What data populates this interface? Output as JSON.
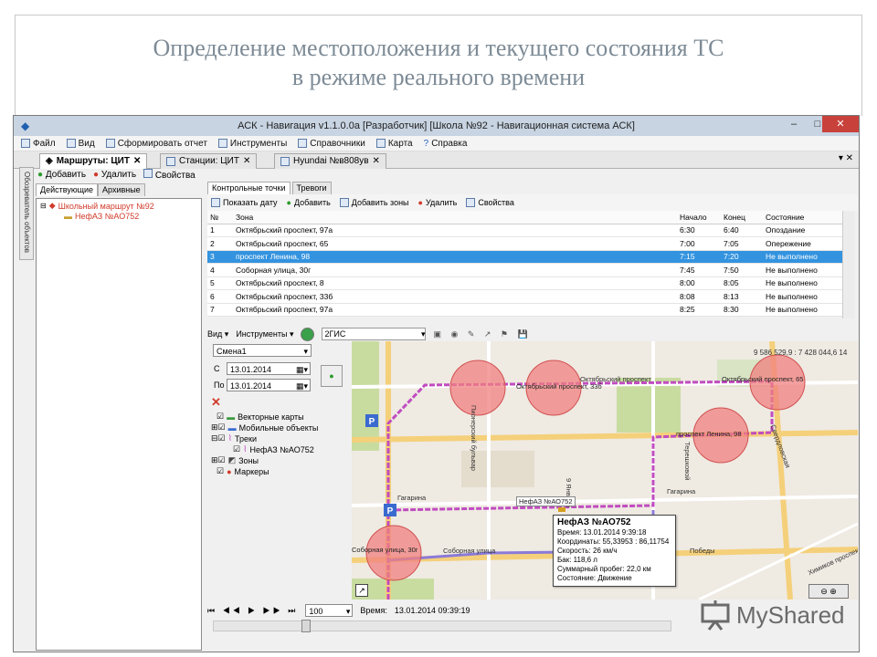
{
  "slide": {
    "title_line1": "Определение местоположения и текущего состояния ТС",
    "title_line2": "в режиме реального времени"
  },
  "window": {
    "title": "АСК - Навигация v1.1.0.0a [Разработчик] [Школа №92 - Навигационная система АСК]",
    "minimize": "–",
    "maximize": "□",
    "close": "✕"
  },
  "menu": [
    "Файл",
    "Вид",
    "Сформировать отчет",
    "Инструменты",
    "Справочники",
    "Карта",
    "Справка"
  ],
  "doc_tabs": [
    "Маршруты: ЦИТ",
    "Станции: ЦИТ",
    "Hyundai №в808ув"
  ],
  "side_vertical_tab": "Обозреватель объектов",
  "left_panel": {
    "toolbar": {
      "add": "Добавить",
      "delete": "Удалить",
      "properties": "Свойства"
    },
    "tabs": [
      "Действующие",
      "Архивные"
    ],
    "tree": {
      "route": "Школьный маршрут №92",
      "vehicle": "НефАЗ №АО752"
    }
  },
  "grid": {
    "tabs": [
      "Контрольные точки",
      "Тревоги"
    ],
    "toolbar": {
      "show_date": "Показать дату",
      "add": "Добавить",
      "add_zones": "Добавить зоны",
      "delete": "Удалить",
      "properties": "Свойства"
    },
    "columns": [
      "№",
      "Зона",
      "Начало",
      "Конец",
      "Состояние"
    ],
    "rows": [
      [
        "1",
        "Октябрьский проспект, 97а",
        "6:30",
        "6:40",
        "Опоздание"
      ],
      [
        "2",
        "Октябрьский проспект, 65",
        "7:00",
        "7:05",
        "Опережение"
      ],
      [
        "3",
        "проспект Ленина, 98",
        "7:15",
        "7:20",
        "Не выполнено"
      ],
      [
        "4",
        "Соборная улица, 30г",
        "7:45",
        "7:50",
        "Не выполнено"
      ],
      [
        "5",
        "Октябрьский проспект, 8",
        "8:00",
        "8:05",
        "Не выполнено"
      ],
      [
        "6",
        "Октябрьский проспект, 33б",
        "8:08",
        "8:13",
        "Не выполнено"
      ],
      [
        "7",
        "Октябрьский проспект, 97а",
        "8:25",
        "8:30",
        "Не выполнено"
      ]
    ],
    "selected_row": 2
  },
  "map_toolbar": {
    "view": "Вид",
    "tools": "Инструменты",
    "provider": "2ГИС"
  },
  "controls": {
    "shift": "Смена1",
    "from_label": "С",
    "from_date": "13.01.2014",
    "to_label": "По",
    "to_date": "13.01.2014",
    "layers": [
      "Векторные карты",
      "Мобильные объекты",
      "Треки",
      "НефАЗ №АО752",
      "Зоны",
      "Маркеры"
    ]
  },
  "map": {
    "coords": "9 586 529,9 : 7 428 044,6 14",
    "streets": [
      "Пионерский бульвар",
      "Октябрьский проспект",
      "Гагарина",
      "Гагарина",
      "Терешковой",
      "Свердловская",
      "Химиков проспект",
      "Соборная улица",
      "Победы",
      "9 Января"
    ],
    "zones": [
      "Октябрьский проспект, 33б",
      "Октябрьский проспект, 65",
      "проспект Ленина, 98",
      "Соборная улица, 30г"
    ],
    "vehicle_label": "НефАЗ №АО752",
    "popup": {
      "title": "НефАЗ №АО752",
      "lines": [
        "Время: 13.01.2014 9:39:18",
        "Координаты: 55,33953 : 86,11754",
        "Скорость: 26 км/ч",
        "Бак: 118,6 л",
        "Суммарный пробег: 22,0 км",
        "Состояние: Движение"
      ]
    },
    "parking": "P",
    "colors": {
      "zone": "#f08080",
      "track": "#c04cc0",
      "road_major": "#f5d07a",
      "park": "#c8dca0"
    }
  },
  "bottom": {
    "zoom": "100",
    "time_label": "Время:",
    "time_value": "13.01.2014 09:39:19"
  },
  "watermark": "MyShared"
}
